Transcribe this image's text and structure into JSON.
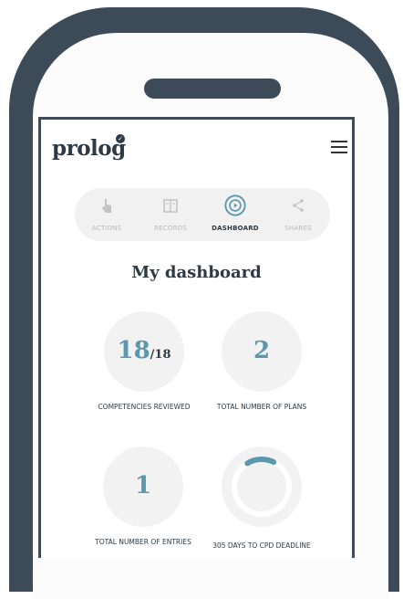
{
  "app": {
    "logo": "prolog"
  },
  "tabs": [
    {
      "label": "ACTIONS",
      "icon": "hand-pointer-icon",
      "active": false
    },
    {
      "label": "RECORDS",
      "icon": "book-icon",
      "active": false
    },
    {
      "label": "DASHBOARD",
      "icon": "dashboard-icon",
      "active": true
    },
    {
      "label": "SHARES",
      "icon": "share-icon",
      "active": false
    }
  ],
  "page": {
    "title": "My dashboard"
  },
  "stats": {
    "competencies": {
      "value": "18",
      "total": "/18",
      "label": "COMPETENCIES REVIEWED"
    },
    "plans": {
      "value": "2",
      "label": "TOTAL NUMBER OF PLANS"
    },
    "entries": {
      "value": "1",
      "label": "TOTAL NUMBER OF ENTRIES"
    },
    "deadline": {
      "label": "305 DAYS TO CPD DEADLINE",
      "progress": 0.16
    }
  },
  "colors": {
    "frame": "#3d4b58",
    "accent": "#5b98ad",
    "inactive": "#b9b9b9"
  }
}
